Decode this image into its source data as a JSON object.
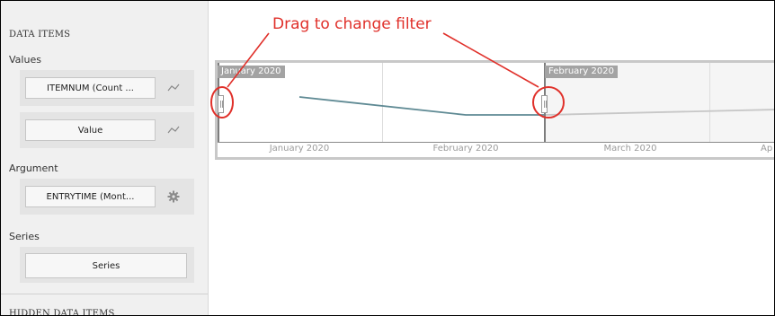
{
  "panel": {
    "data_items": "DATA ITEMS",
    "values_caption": "Values",
    "value_items": [
      {
        "label": "ITEMNUM (Count ...",
        "icon": "sparkline-icon"
      },
      {
        "label": "Value",
        "icon": "sparkline-icon"
      }
    ],
    "argument_caption": "Argument",
    "argument_item": {
      "label": "ENTRYTIME (Mont...",
      "icon": "gear-icon"
    },
    "series_caption": "Series",
    "series_item": {
      "label": "Series"
    },
    "hidden_items": "HIDDEN DATA ITEMS"
  },
  "range": {
    "selection_start_label": "January 2020",
    "selection_end_label": "February 2020",
    "axis_labels": [
      "January 2020",
      "February 2020",
      "March 2020",
      "Ap"
    ],
    "line_color": "#5f8a94",
    "faded_line_color": "#c7c7c7"
  },
  "annotation": {
    "text": "Drag to change filter",
    "color": "#e0302a"
  }
}
